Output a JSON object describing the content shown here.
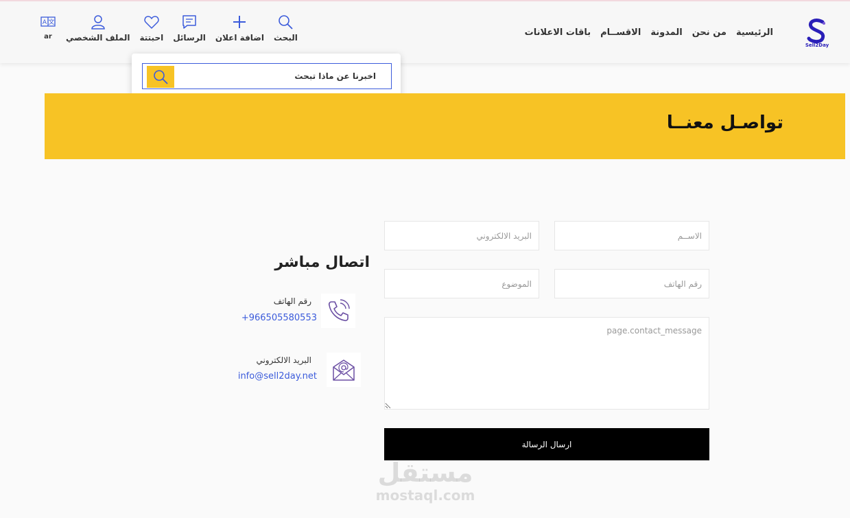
{
  "header": {
    "logo_text": "Sell2Day",
    "nav": [
      {
        "label": "الرئيسية",
        "name": "nav-home"
      },
      {
        "label": "من نحن",
        "name": "nav-about"
      },
      {
        "label": "المدونة",
        "name": "nav-blog"
      },
      {
        "label": "الاقســام",
        "name": "nav-categories"
      },
      {
        "label": "باقات الاعلانات",
        "name": "nav-ad-packages"
      }
    ],
    "tools": {
      "search": "البحث",
      "add_ad": "اضافة اعلان",
      "messages": "الرسائل",
      "favorites": "احبتتة",
      "profile": "الملف الشخصي",
      "language": "ar"
    }
  },
  "search": {
    "placeholder": "اخبرنا عن ماذا تبحث"
  },
  "banner": {
    "title": "تواصـل معنــا"
  },
  "form": {
    "name_placeholder": "الاســم",
    "email_placeholder": "البريد الالكتروني",
    "phone_placeholder": "رقم الهاتف",
    "subject_placeholder": "الموضوع",
    "message_placeholder": "page.contact_message",
    "submit_label": "ارسال الرسالة"
  },
  "direct_contact": {
    "title": "اتصال مباشر",
    "phone_label": "رقم الهاتف",
    "phone_value": "+966505580553",
    "email_label": "البريد الالكتروني",
    "email_value": "info@sell2day.net"
  },
  "watermark": {
    "arabic": "مستقل",
    "latin": "mostaql.com"
  },
  "colors": {
    "accent_yellow": "#f7c325",
    "link_blue": "#3b5bdb",
    "submit_black": "#000000",
    "icon_blue": "#3b5bdb"
  }
}
